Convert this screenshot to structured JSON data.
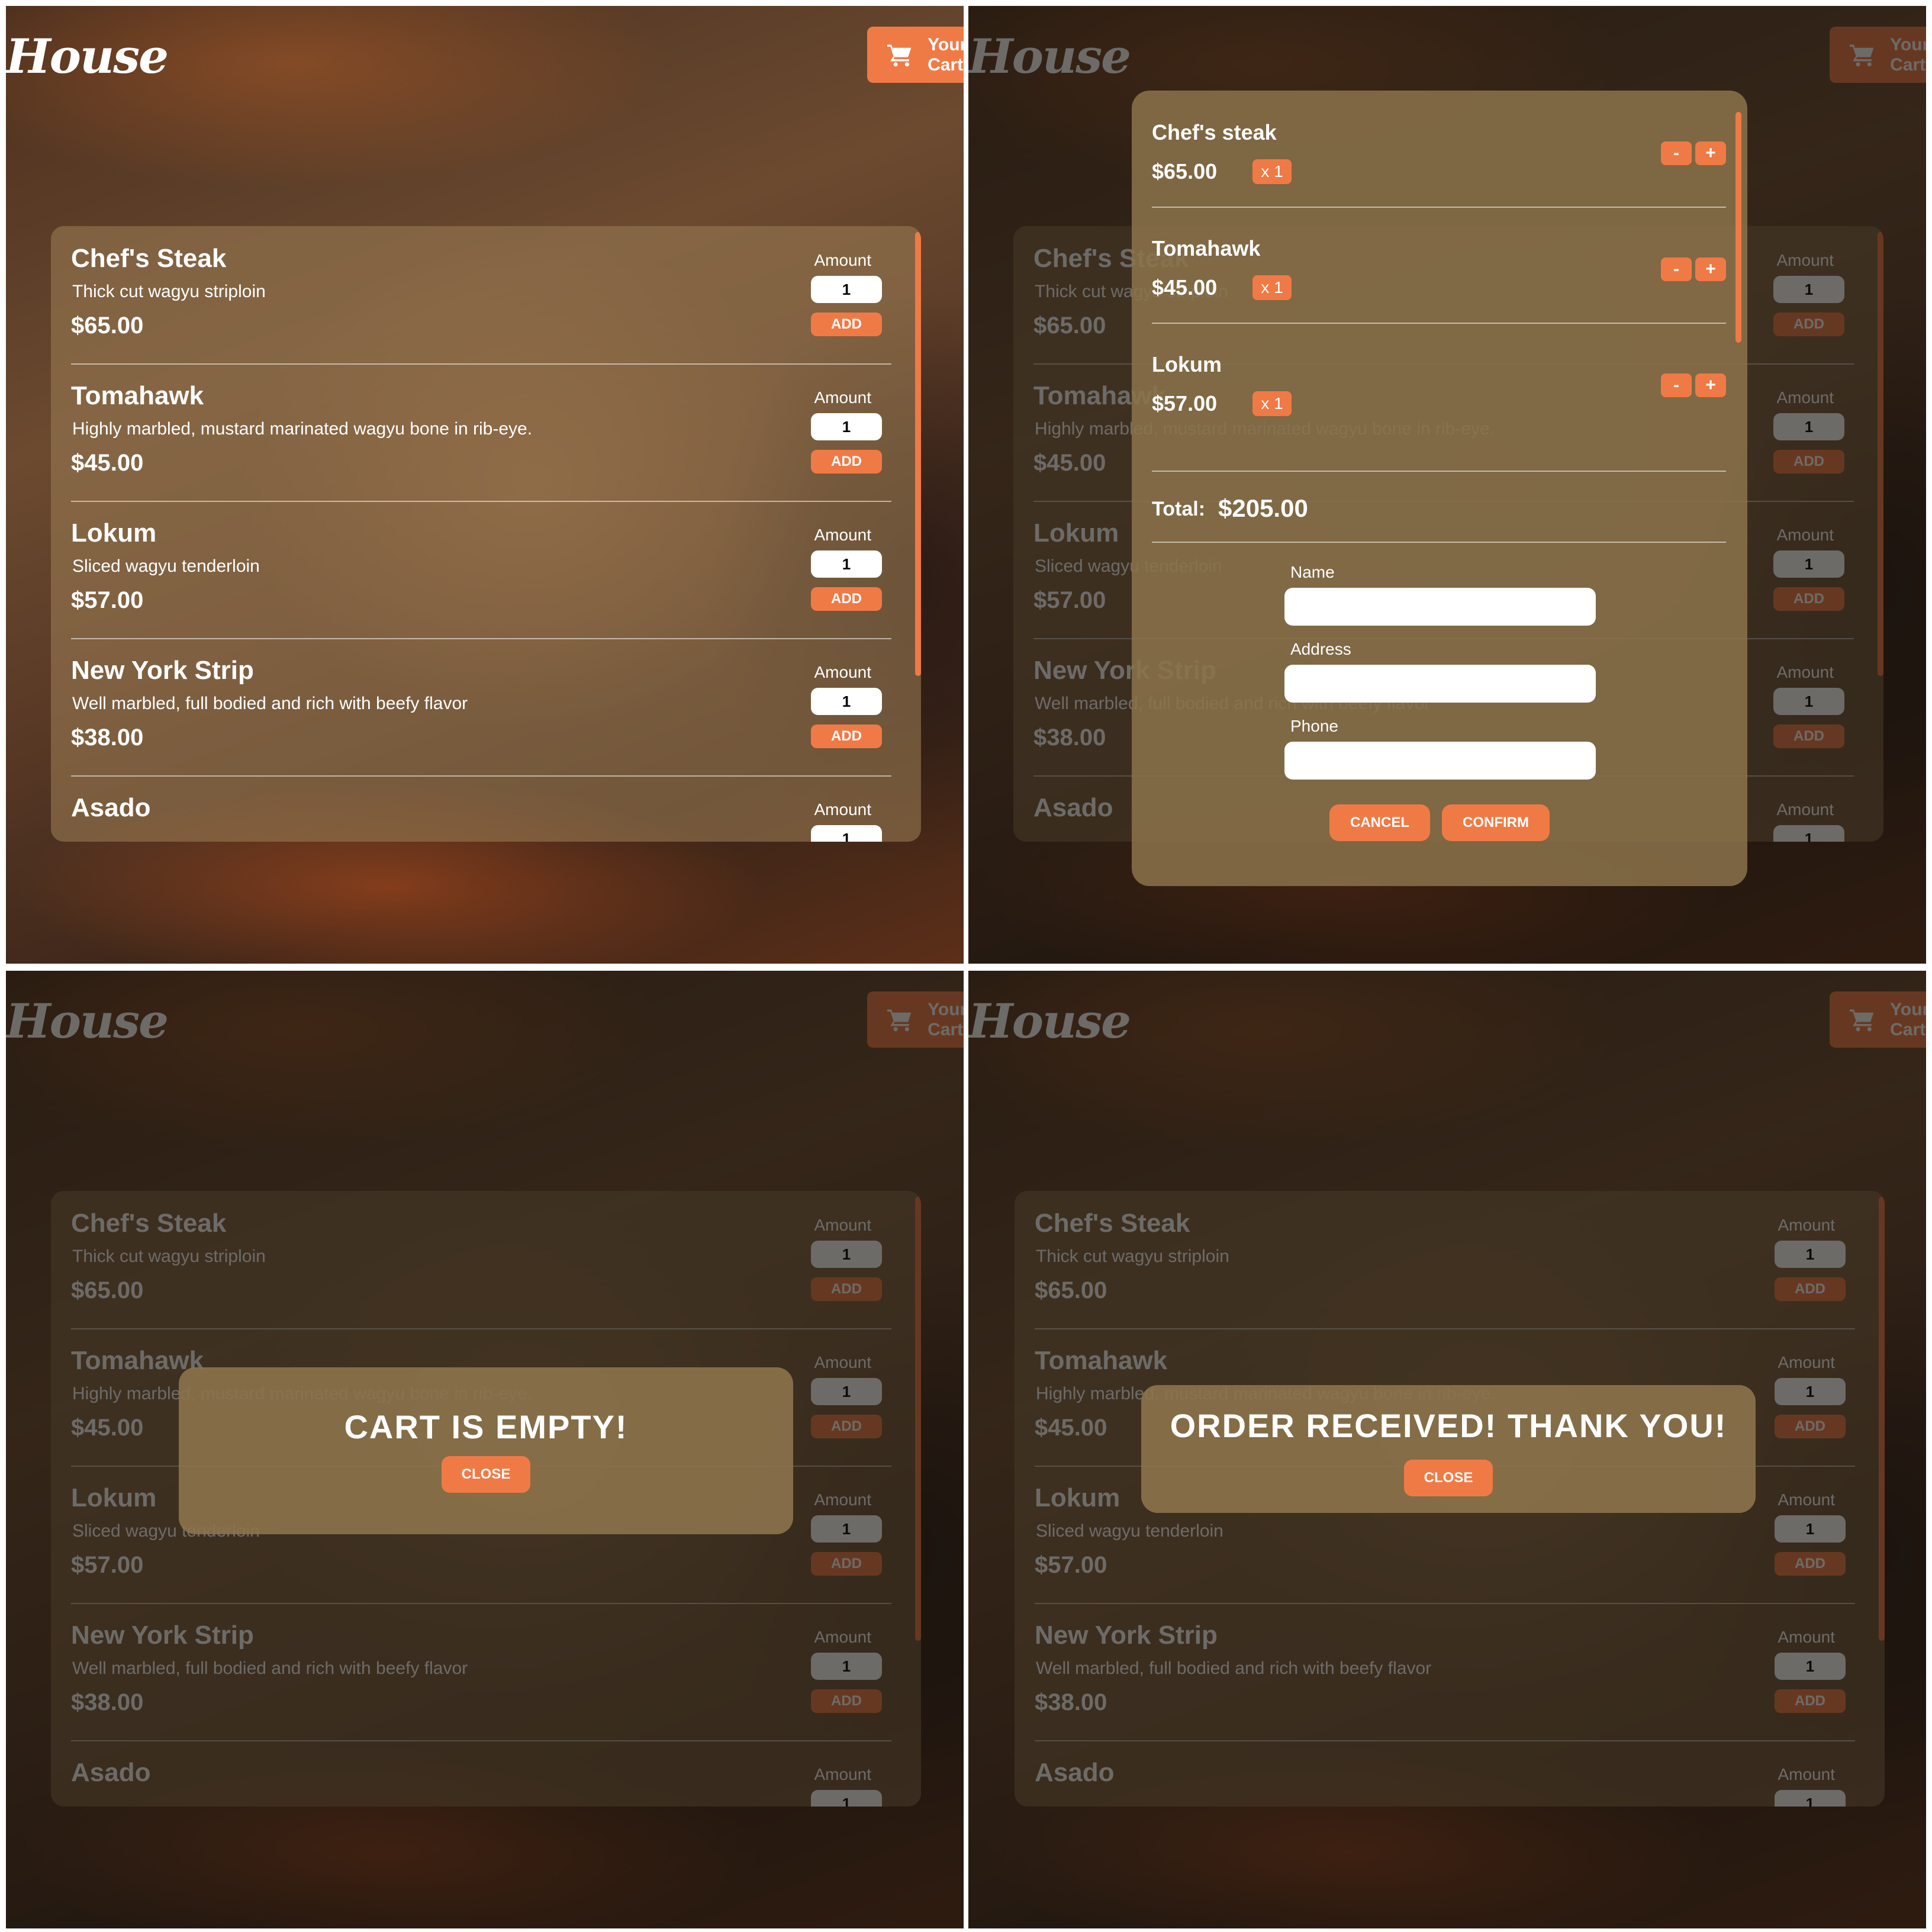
{
  "header": {
    "logo": "House",
    "cart_button_label": "Your Cart"
  },
  "menu": {
    "amount_label": "Amount",
    "add_label": "ADD",
    "items": [
      {
        "name": "Chef's Steak",
        "description": "Thick cut wagyu striploin",
        "price": "$65.00",
        "amount": "1"
      },
      {
        "name": "Tomahawk",
        "description": "Highly marbled, mustard marinated wagyu bone in rib-eye.",
        "price": "$45.00",
        "amount": "1"
      },
      {
        "name": "Lokum",
        "description": "Sliced wagyu tenderloin",
        "price": "$57.00",
        "amount": "1"
      },
      {
        "name": "New York Strip",
        "description": "Well marbled, full bodied and rich with beefy flavor",
        "price": "$38.00",
        "amount": "1"
      },
      {
        "name": "Asado",
        "description": "",
        "price": "",
        "amount": "1"
      }
    ]
  },
  "cart_modal": {
    "items": [
      {
        "name": "Chef's steak",
        "price": "$65.00",
        "qty": "x 1"
      },
      {
        "name": "Tomahawk",
        "price": "$45.00",
        "qty": "x 1"
      },
      {
        "name": "Lokum",
        "price": "$57.00",
        "qty": "x 1"
      }
    ],
    "minus_label": "-",
    "plus_label": "+",
    "total_label": "Total:",
    "total_value": "$205.00",
    "form": {
      "name_label": "Name",
      "address_label": "Address",
      "phone_label": "Phone"
    },
    "cancel_label": "CANCEL",
    "confirm_label": "CONFIRM"
  },
  "empty_modal": {
    "message": "CART IS EMPTY!",
    "close_label": "CLOSE"
  },
  "order_modal": {
    "message": "ORDER RECEIVED! THANK YOU!",
    "close_label": "CLOSE"
  },
  "colors": {
    "accent": "#f07a45",
    "card": "#8c734b",
    "text": "#ffffff"
  },
  "icons": {
    "cart": "shopping-cart-icon"
  }
}
